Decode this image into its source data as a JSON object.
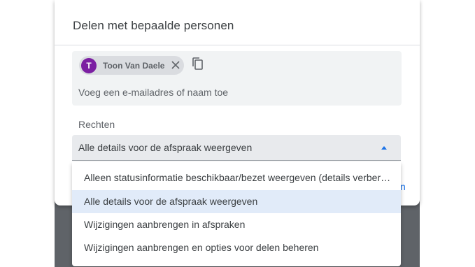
{
  "dialog": {
    "title": "Delen met bepaalde personen"
  },
  "recipients": {
    "chips": [
      {
        "initial": "T",
        "name": "Toon Van Daele",
        "avatar_color": "#7b1fa2"
      }
    ],
    "input_placeholder": "Voeg een e-mailadres of naam toe",
    "input_value": ""
  },
  "permissions": {
    "label": "Rechten",
    "selected": "Alle details voor de afspraak weergeven",
    "options": [
      "Alleen statusinformatie beschikbaar/bezet weergeven (details verbergen)",
      "Alle details voor de afspraak weergeven",
      "Wijzigingen aanbrengen in afspraken",
      "Wijzigingen aanbrengen en opties voor delen beheren"
    ],
    "selected_index": 1
  },
  "footer_peek": "n",
  "colors": {
    "accent": "#1a73e8",
    "selected_option_bg": "#e1ebf9",
    "backdrop": "#5f6368"
  }
}
